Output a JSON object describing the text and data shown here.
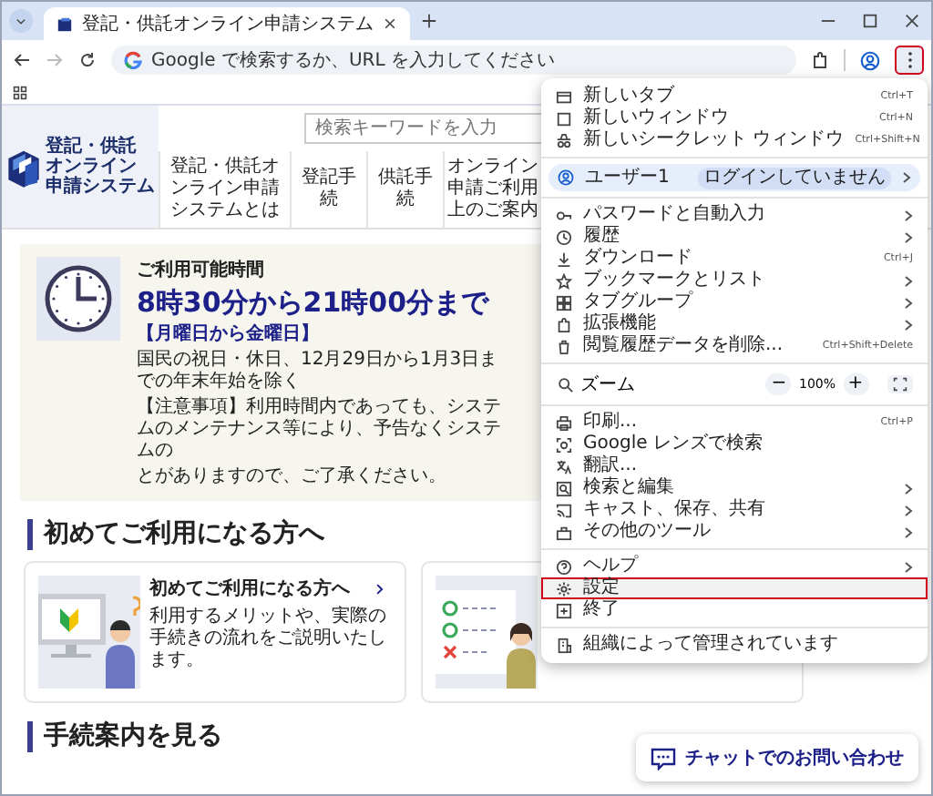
{
  "browser_tabs": [
    {
      "title": "登記・供託オンライン申請システム",
      "selected": true
    }
  ],
  "address_bar": {
    "placeholder": "Google で検索するか、URL を入力してください"
  },
  "toolbar": {
    "menu_button": {
      "highlighted": true
    }
  },
  "site": {
    "logo": [
      "登記・供託",
      "オンライン",
      "申請システム"
    ],
    "search": {
      "placeholder": "検索キーワードを入力"
    },
    "nav": [
      "登記・供託オンライン申請システムとは",
      "登記手続",
      "供託手続",
      "オンライン申請ご利用上のご案内"
    ]
  },
  "hours": {
    "label": "ご利用可能時間",
    "time": "8時30分から21時00分まで",
    "days": "【月曜日から金曜日】",
    "holidays": "国民の祝日・休日、12月29日から1月3日までの年末年始を除く",
    "notice": [
      "【注意事項】利用時間内であっても、システムのメンテナンス等により、予告なくシステムの",
      "とがありますので、ご了承ください。"
    ]
  },
  "sections": [
    {
      "heading": "初めてご利用になる方へ",
      "cards": [
        {
          "kind": "guide",
          "title": "初めてご利用になる方へ",
          "text": "利用するメリットや、実際の手続きの流れをご説明いたします。"
        },
        {
          "kind": "checklist"
        }
      ]
    },
    {
      "heading": "手続案内を見る"
    }
  ],
  "menu": {
    "items": [
      {
        "kind": "item",
        "label": "新しいタブ",
        "shortcut": "Ctrl+T",
        "submenu": false,
        "highlighted": false
      },
      {
        "kind": "item",
        "label": "新しいウィンドウ",
        "shortcut": "Ctrl+N",
        "submenu": false,
        "highlighted": false
      },
      {
        "kind": "item",
        "label": "新しいシークレット ウィンドウ",
        "shortcut": "Ctrl+Shift+N",
        "submenu": false,
        "highlighted": false
      },
      {
        "kind": "separator"
      },
      {
        "kind": "profile",
        "label": "ユーザー1",
        "badge": "ログインしていません",
        "submenu": true,
        "highlighted": false
      },
      {
        "kind": "separator"
      },
      {
        "kind": "item",
        "label": "パスワードと自動入力",
        "submenu": true,
        "highlighted": false
      },
      {
        "kind": "item",
        "label": "履歴",
        "submenu": true,
        "highlighted": false
      },
      {
        "kind": "item",
        "label": "ダウンロード",
        "shortcut": "Ctrl+J",
        "submenu": false,
        "highlighted": false
      },
      {
        "kind": "item",
        "label": "ブックマークとリスト",
        "submenu": true,
        "highlighted": false
      },
      {
        "kind": "item",
        "label": "タブグループ",
        "submenu": true,
        "highlighted": false
      },
      {
        "kind": "item",
        "label": "拡張機能",
        "submenu": true,
        "highlighted": false
      },
      {
        "kind": "item",
        "label": "閲覧履歴データを削除...",
        "shortcut": "Ctrl+Shift+Delete",
        "submenu": false,
        "highlighted": false
      },
      {
        "kind": "separator"
      },
      {
        "kind": "zoom",
        "label": "ズーム",
        "minus": "−",
        "value": "100%",
        "plus": "+"
      },
      {
        "kind": "separator"
      },
      {
        "kind": "item",
        "label": "印刷...",
        "shortcut": "Ctrl+P",
        "submenu": false,
        "highlighted": false
      },
      {
        "kind": "item",
        "label": "Google レンズで検索",
        "submenu": false,
        "highlighted": false
      },
      {
        "kind": "item",
        "label": "翻訳...",
        "submenu": false,
        "highlighted": false
      },
      {
        "kind": "item",
        "label": "検索と編集",
        "submenu": true,
        "highlighted": false
      },
      {
        "kind": "item",
        "label": "キャスト、保存、共有",
        "submenu": true,
        "highlighted": false
      },
      {
        "kind": "item",
        "label": "その他のツール",
        "submenu": true,
        "highlighted": false
      },
      {
        "kind": "separator"
      },
      {
        "kind": "item",
        "label": "ヘルプ",
        "submenu": true,
        "highlighted": false
      },
      {
        "kind": "item",
        "label": "設定",
        "submenu": false,
        "highlighted": true
      },
      {
        "kind": "item",
        "label": "終了",
        "submenu": false,
        "highlighted": false
      },
      {
        "kind": "separator"
      },
      {
        "kind": "item",
        "label": "組織によって管理されています",
        "submenu": false,
        "highlighted": false
      }
    ]
  },
  "chat_button": {
    "label": "チャットでのお問い合わせ"
  }
}
